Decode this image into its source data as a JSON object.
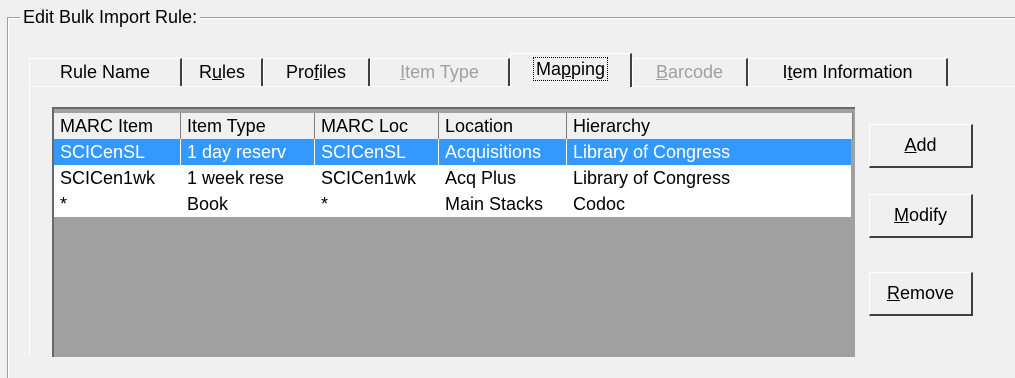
{
  "group": {
    "title": "Edit Bulk Import Rule:"
  },
  "tabs": [
    {
      "label": "Rule Name",
      "accel": "",
      "rest": ""
    },
    {
      "label": "R",
      "accel": "u",
      "rest": "les"
    },
    {
      "label": "Pro",
      "accel": "f",
      "rest": "iles"
    },
    {
      "label": "",
      "accel": "I",
      "rest": "tem Type"
    },
    {
      "label": "Ma",
      "accel": "p",
      "rest": "ping"
    },
    {
      "label": "",
      "accel": "B",
      "rest": "arcode"
    },
    {
      "label": "I",
      "accel": "t",
      "rest": "em Information"
    }
  ],
  "table": {
    "columns": [
      "MARC Item",
      "Item Type",
      "MARC Loc",
      "Location",
      "Hierarchy"
    ],
    "rows": [
      [
        "SCICenSL",
        "1 day reserv",
        "SCICenSL",
        "Acquisitions",
        "Library of Congress"
      ],
      [
        "SCICen1wk",
        "1 week rese",
        "SCICen1wk",
        "Acq Plus",
        "Library of Congress"
      ],
      [
        "*",
        "Book",
        "*",
        "Main Stacks",
        "Codoc"
      ]
    ],
    "selected_row": 0
  },
  "buttons": {
    "add": {
      "accel": "A",
      "rest": "dd"
    },
    "modify": {
      "accel": "M",
      "rest": "odify"
    },
    "remove": {
      "accel": "R",
      "rest": "emove"
    }
  }
}
